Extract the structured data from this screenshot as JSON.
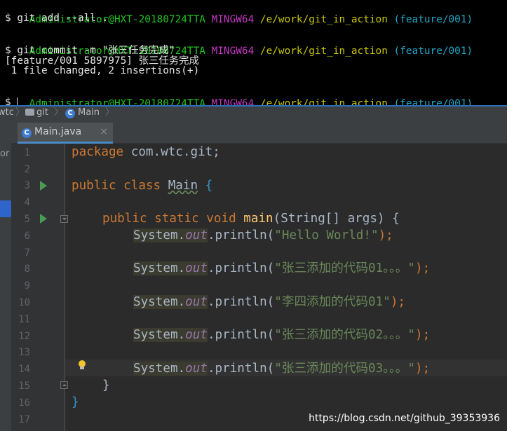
{
  "terminal": {
    "prompt": {
      "user": "Administrator@HXT-20180724TTA",
      "env": "MINGW64",
      "path": "/e/work/git_in_action",
      "branch": "(feature/001)"
    },
    "cmd1": "$ git add --all .",
    "cmd2": "$ git commit -m \"张三任务完成\"",
    "out1": "[feature/001 5897975] 张三任务完成",
    "out2": " 1 file changed, 2 insertions(+)",
    "cmd3": "$ "
  },
  "breadcrumb": {
    "left_fragment": "wtc",
    "folder": "git",
    "file": "Main",
    "left_panel_fragment": "or"
  },
  "tab": {
    "label": "Main.java",
    "close": "×"
  },
  "lines": {
    "l1": "1",
    "l2": "2",
    "l3": "3",
    "l4": "4",
    "l5": "5",
    "l6": "6",
    "l7": "7",
    "l8": "8",
    "l9": "9",
    "l10": "10",
    "l11": "11",
    "l12": "12",
    "l13": "13",
    "l14": "14",
    "l15": "15",
    "l16": "16",
    "l17": "17"
  },
  "code": {
    "package_kw": "package",
    "package_name": " com.wtc.git;",
    "class_mods": "public class ",
    "class_name": "Main",
    "class_open": " {",
    "method_mods": "public static void ",
    "method_name": "main",
    "method_sig": "(String[] args) {",
    "sys": "System",
    "dot": ".",
    "out": "out",
    "println": ".println(",
    "str6": "\"Hello World!\"",
    "str8": "\"张三添加的代码01。。。\"",
    "str10": "\"李四添加的代码01\"",
    "str12": "\"张三添加的代码02。。。\"",
    "str14": "\"张三添加的代码03。。。\"",
    "close_call": ");",
    "brace_close": "}"
  },
  "watermark": "https://blog.csdn.net/github_39353936",
  "icons": {
    "c_badge": "C",
    "run": "run-gutter-icon",
    "fold": "fold-icon",
    "bulb": "intention-bulb-icon"
  },
  "colors": {
    "keyword": "#cc7832",
    "method": "#ffc66d",
    "string": "#6a8759",
    "field": "#9876aa",
    "prompt_user": "#1fc51f",
    "prompt_env": "#c33ac3",
    "prompt_path": "#c7c400",
    "prompt_branch": "#24a7c9"
  }
}
